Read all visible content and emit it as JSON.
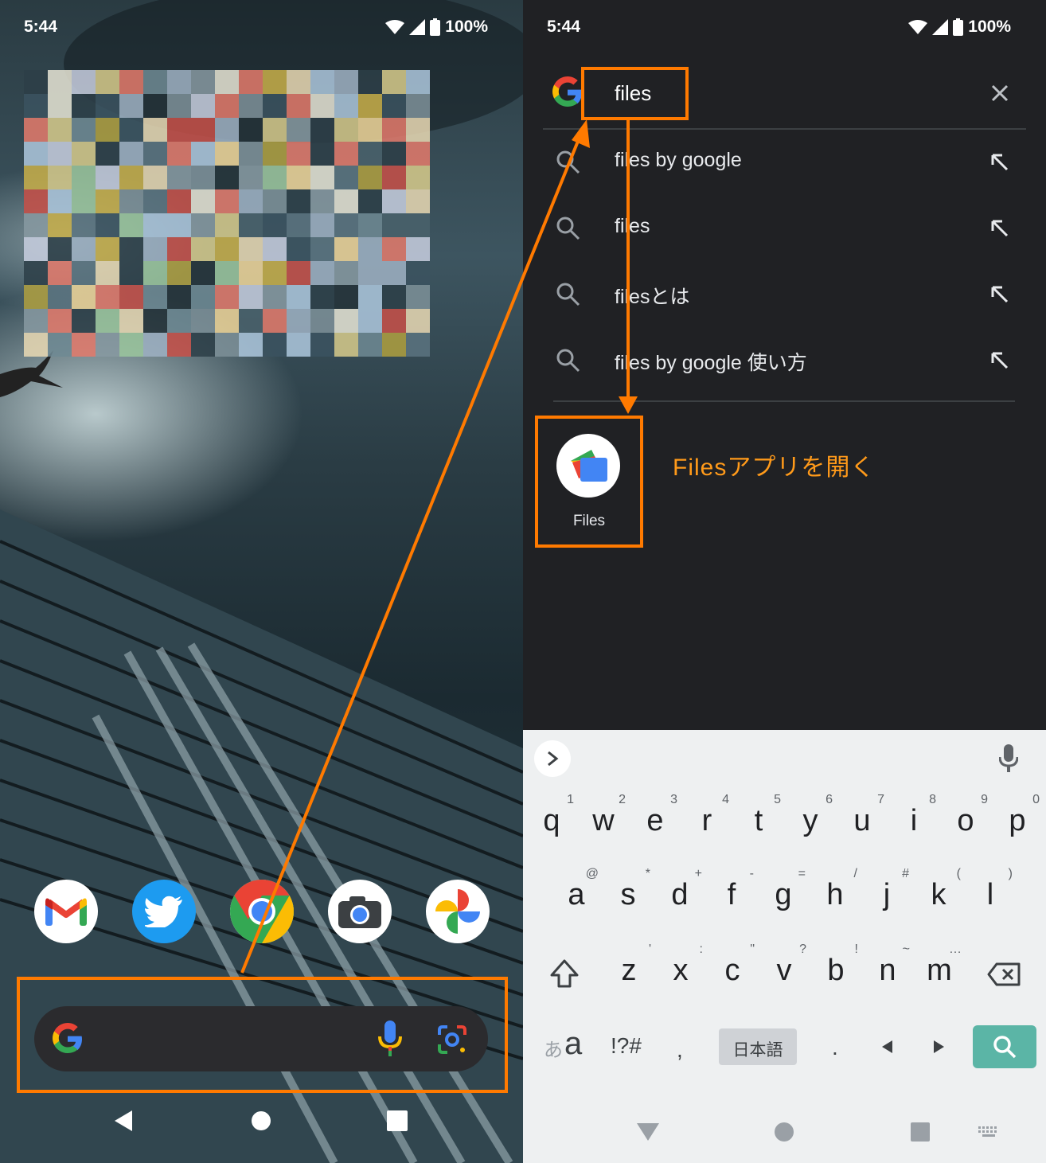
{
  "left": {
    "status": {
      "time": "5:44",
      "battery": "100%"
    },
    "dock": [
      {
        "name": "gmail-icon"
      },
      {
        "name": "twitter-icon"
      },
      {
        "name": "chrome-icon"
      },
      {
        "name": "camera-icon"
      },
      {
        "name": "photos-icon"
      }
    ]
  },
  "right": {
    "status": {
      "time": "5:44",
      "battery": "100%"
    },
    "search": {
      "query": "files"
    },
    "suggestions": [
      {
        "label": "files by google"
      },
      {
        "label": "files"
      },
      {
        "label": "filesとは"
      },
      {
        "label": "files by google 使い方"
      }
    ],
    "app_result": {
      "label": "Files"
    },
    "annotation": "Filesアプリを開く",
    "keyboard": {
      "row1": [
        {
          "k": "q",
          "s": "1"
        },
        {
          "k": "w",
          "s": "2"
        },
        {
          "k": "e",
          "s": "3"
        },
        {
          "k": "r",
          "s": "4"
        },
        {
          "k": "t",
          "s": "5"
        },
        {
          "k": "y",
          "s": "6"
        },
        {
          "k": "u",
          "s": "7"
        },
        {
          "k": "i",
          "s": "8"
        },
        {
          "k": "o",
          "s": "9"
        },
        {
          "k": "p",
          "s": "0"
        }
      ],
      "row2": [
        {
          "k": "a",
          "s": "@"
        },
        {
          "k": "s",
          "s": "*"
        },
        {
          "k": "d",
          "s": "+"
        },
        {
          "k": "f",
          "s": "-"
        },
        {
          "k": "g",
          "s": "="
        },
        {
          "k": "h",
          "s": "/"
        },
        {
          "k": "j",
          "s": "#"
        },
        {
          "k": "k",
          "s": "("
        },
        {
          "k": "l",
          "s": ")"
        }
      ],
      "row3": [
        {
          "k": "z",
          "s": "'"
        },
        {
          "k": "x",
          "s": ":"
        },
        {
          "k": "c",
          "s": "\""
        },
        {
          "k": "v",
          "s": "?"
        },
        {
          "k": "b",
          "s": "!"
        },
        {
          "k": "n",
          "s": "~"
        },
        {
          "k": "m",
          "s": "…"
        }
      ],
      "lang_a": "あ",
      "lang_b": "a",
      "symbols": "!?#",
      "comma": ",",
      "japanese": "日本語",
      "period": "."
    },
    "colors": {
      "accent": "#ff7a00",
      "search_key": "#5bb5a6"
    }
  }
}
